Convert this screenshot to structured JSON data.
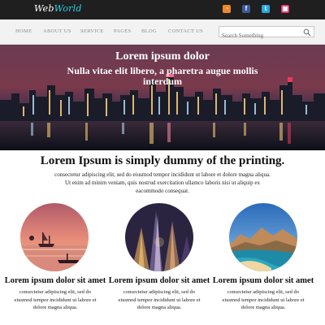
{
  "header": {
    "logo_part1": "Web",
    "logo_part2": "World",
    "social": [
      {
        "name": "rss-icon",
        "glyph": "◔",
        "color": "#f0862a"
      },
      {
        "name": "facebook-icon",
        "glyph": "f",
        "color": "#3b5a9a"
      },
      {
        "name": "twitter-icon",
        "glyph": "t",
        "color": "#2aa7e0"
      },
      {
        "name": "instagram-icon",
        "glyph": "▣",
        "color": "#e1306c"
      }
    ]
  },
  "nav": {
    "items": [
      "HOME",
      "ABOUT US",
      "SERVICE",
      "PAGES",
      "BLOG",
      "CONTACT US"
    ],
    "search_placeholder": "Search Something"
  },
  "hero": {
    "title": "Lorem ipsum dolor",
    "subtitle": "Nulla vitae elit libero, a pharetra augue mollis interdum"
  },
  "main": {
    "headline": "Lorem Ipsum is simply dummy of the printing.",
    "intro": "consectetur adipiscing elit, sed do eiusmod tempor incididunt ut labore et dolore magna aliqua. Ut enim ad minim veniam, quis nostrud exercitation ullamco laboris nisi ut aliquip ex eacommodo consequat."
  },
  "features": [
    {
      "title": "Lorem ipsum dolor sit amet",
      "text": "consectetur adipiscing elit, sed do eiusmod tempor incididunt ut labore et dolore magna aliqua."
    },
    {
      "title": "Lorem ipsum dolor sit amet",
      "text": "consectetur adipiscing elit, sed do eiusmod tempor incididunt ut labore et dolore magna aliqua."
    },
    {
      "title": "Lorem ipsum dolor sit amet",
      "text": "consectetur adipiscing elit, sed do eiusmod tempor incididunt ut labore et dolore magna aliqua."
    }
  ],
  "colors": {
    "accent": "#29d3e8",
    "topbar": "#1f1f1f",
    "nav_bg": "#f2f2f2"
  }
}
